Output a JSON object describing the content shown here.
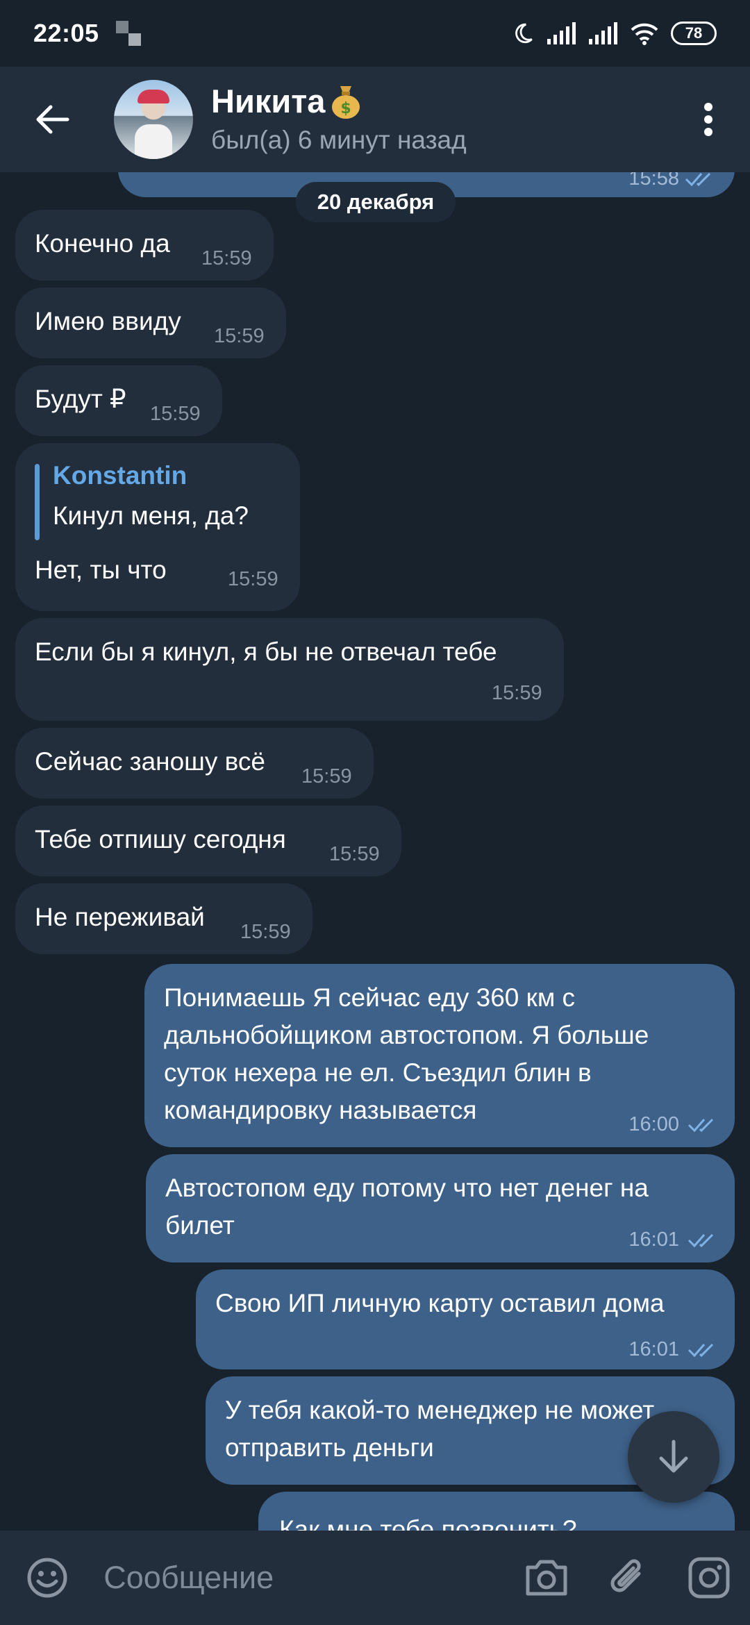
{
  "status_bar": {
    "time": "22:05",
    "battery": "78",
    "icons": [
      "moon-icon",
      "signal-icon",
      "signal-icon",
      "wifi-icon",
      "battery-icon"
    ]
  },
  "header": {
    "name": "Никита",
    "status": "был(а) 6 минут назад",
    "name_emoji": "moneybag-icon"
  },
  "chat": {
    "date_separator": "20 декабря",
    "top_partial_time": "15:58",
    "messages": [
      {
        "dir": "in",
        "text": "Конечно да",
        "time": "15:59"
      },
      {
        "dir": "in",
        "text": "Имею ввиду",
        "time": "15:59"
      },
      {
        "dir": "in",
        "text": "Будут ₽",
        "time": "15:59"
      },
      {
        "dir": "in",
        "reply_author": "Konstantin",
        "reply_text": "Кинул меня, да?",
        "text": "Нет, ты что",
        "time": "15:59"
      },
      {
        "dir": "in",
        "text": "Если бы я кинул, я бы не отвечал тебе",
        "time": "15:59"
      },
      {
        "dir": "in",
        "text": "Сейчас заношу всё",
        "time": "15:59"
      },
      {
        "dir": "in",
        "text": "Тебе отпишу сегодня",
        "time": "15:59"
      },
      {
        "dir": "in",
        "text": "Не переживай",
        "time": "15:59"
      },
      {
        "dir": "out",
        "text": "Понимаешь Я сейчас еду 360 км с\nдальнобойщиком автостопом. Я больше\nсуток нехера не ел. Съездил блин в\nкомандировку называется",
        "time": "16:00"
      },
      {
        "dir": "out",
        "text": "Автостопом еду потому что нет денег на\nбилет",
        "time": "16:01"
      },
      {
        "dir": "out",
        "text": "Свою ИП личную карту оставил дома",
        "time": "16:01"
      },
      {
        "dir": "out",
        "text": "У тебя какой-то менеджер не может\nотправить деньги",
        "time": ""
      },
      {
        "dir": "out",
        "text": "Как мне тебе позвонить?",
        "time": ""
      }
    ]
  },
  "input": {
    "placeholder": "Сообщение"
  },
  "colors": {
    "background": "#18222d",
    "incoming_bubble": "#232e3c",
    "outgoing_bubble": "#3e6189",
    "accent": "#64a8e6"
  }
}
